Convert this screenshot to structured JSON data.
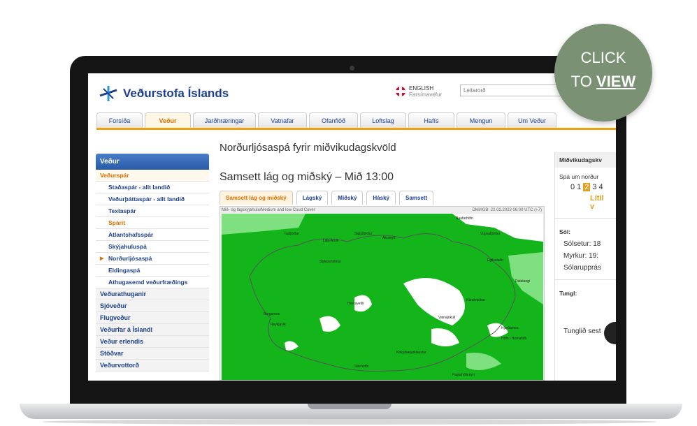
{
  "logo": {
    "text": "Veðurstofa Íslands"
  },
  "language": {
    "label": "ENGLISH",
    "sublabel": "Farsímavefur"
  },
  "search": {
    "placeholder": "Leitarorð"
  },
  "nav": {
    "tabs": [
      "Forsíða",
      "Veður",
      "Jarðhræringar",
      "Vatnafar",
      "Ofanflóð",
      "Loftslag",
      "Hafís",
      "Mengun",
      "Um Veður"
    ],
    "active": "Veður"
  },
  "sidebar": {
    "header": "Veður",
    "items": [
      {
        "label": "Veðurspár",
        "kind": "accent"
      },
      {
        "label": "Staðaspár - allt landið",
        "kind": "sub"
      },
      {
        "label": "Veðurþáttaspár - allt landið",
        "kind": "sub"
      },
      {
        "label": "Textaspár",
        "kind": "sub"
      },
      {
        "label": "Spárit",
        "kind": "sub-orange"
      },
      {
        "label": "Atlantshafsspár",
        "kind": "sub"
      },
      {
        "label": "Skýjahuluspá",
        "kind": "sub"
      },
      {
        "label": "Norðurljósaspá",
        "kind": "current"
      },
      {
        "label": "Eldingaspá",
        "kind": "sub"
      },
      {
        "label": "Athugasemd veðurfræðings",
        "kind": "sub"
      },
      {
        "label": "Veðurathuganir",
        "kind": "top"
      },
      {
        "label": "Sjóveður",
        "kind": "top"
      },
      {
        "label": "Flugveður",
        "kind": "top"
      },
      {
        "label": "Veðurfar á Íslandi",
        "kind": "top"
      },
      {
        "label": "Veður erlendis",
        "kind": "top"
      },
      {
        "label": "Stöðvar",
        "kind": "top"
      },
      {
        "label": "Veðurvottorð",
        "kind": "top"
      }
    ]
  },
  "main": {
    "title": "Norðurljósaspá fyrir miðvikudagskvöld",
    "section_title": "Samsett lág og miðský – Mið 13:00",
    "subtabs": [
      "Samsett lág og miðský",
      "Lágský",
      "Miðský",
      "Háský",
      "Samsett"
    ],
    "active_subtab": "Samsett lág og miðský",
    "map": {
      "caption": "Mið- og lágskýjahula/Medium and low Coud Cover",
      "date": "DMI/IGB: 22.02.2023 06:00 UTC (+7)",
      "places": [
        "Raufarhöfn",
        "Vopnafjörður",
        "Akureyri",
        "Ísafjörður",
        "Litla-Árvík",
        "Siglufjörður",
        "Stykkishólmur",
        "Dalatangi",
        "Egilsstaðir",
        "Kárahnjúkar",
        "Höfn í Hornafirði",
        "Vatnajökull",
        "Hveravellir",
        "Borgarnes",
        "Reykjavík",
        "Kirkjubæjarklaustur",
        "Stórhöfði",
        "Hjarðarnes",
        "Fagurhólsmýri"
      ]
    }
  },
  "right_panel": {
    "title": "Miðvikudagskv",
    "forecast_label": "Spá um norður",
    "kp_values": [
      "0",
      "1",
      "2",
      "3",
      "4"
    ],
    "kp_selected": "2",
    "kp_text": "Lítil v",
    "sun_title": "Sól:",
    "sunset": "Sólsetur: 18",
    "dark": "Myrkur: 19:",
    "sunrise": "Sólarupprás",
    "moon_title": "Tungl:",
    "moonset": "Tunglið sest"
  },
  "cta": {
    "line1": "CLICK",
    "line2_prefix": "TO ",
    "line2_bold": "VIEW"
  },
  "colors": {
    "brand": "#1c3f8f",
    "accent": "#e07000",
    "cloud_green": "#13b51a",
    "cta_bg": "#7a9173"
  }
}
